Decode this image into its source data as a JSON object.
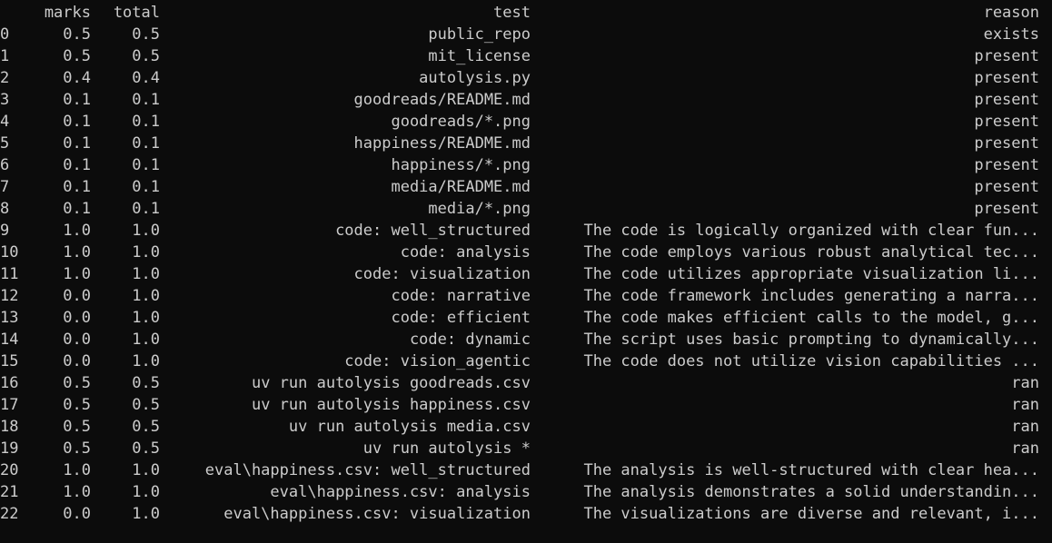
{
  "header": {
    "index": "",
    "marks": "marks",
    "total": "total",
    "test": "test",
    "reason": "reason"
  },
  "rows": [
    {
      "index": "0",
      "marks": "0.5",
      "total": "0.5",
      "test": "public_repo",
      "reason": "exists"
    },
    {
      "index": "1",
      "marks": "0.5",
      "total": "0.5",
      "test": "mit_license",
      "reason": "present"
    },
    {
      "index": "2",
      "marks": "0.4",
      "total": "0.4",
      "test": "autolysis.py",
      "reason": "present"
    },
    {
      "index": "3",
      "marks": "0.1",
      "total": "0.1",
      "test": "goodreads/README.md",
      "reason": "present"
    },
    {
      "index": "4",
      "marks": "0.1",
      "total": "0.1",
      "test": "goodreads/*.png",
      "reason": "present"
    },
    {
      "index": "5",
      "marks": "0.1",
      "total": "0.1",
      "test": "happiness/README.md",
      "reason": "present"
    },
    {
      "index": "6",
      "marks": "0.1",
      "total": "0.1",
      "test": "happiness/*.png",
      "reason": "present"
    },
    {
      "index": "7",
      "marks": "0.1",
      "total": "0.1",
      "test": "media/README.md",
      "reason": "present"
    },
    {
      "index": "8",
      "marks": "0.1",
      "total": "0.1",
      "test": "media/*.png",
      "reason": "present"
    },
    {
      "index": "9",
      "marks": "1.0",
      "total": "1.0",
      "test": "code: well_structured",
      "reason": "The code is logically organized with clear fun..."
    },
    {
      "index": "10",
      "marks": "1.0",
      "total": "1.0",
      "test": "code: analysis",
      "reason": "The code employs various robust analytical tec..."
    },
    {
      "index": "11",
      "marks": "1.0",
      "total": "1.0",
      "test": "code: visualization",
      "reason": "The code utilizes appropriate visualization li..."
    },
    {
      "index": "12",
      "marks": "0.0",
      "total": "1.0",
      "test": "code: narrative",
      "reason": "The code framework includes generating a narra..."
    },
    {
      "index": "13",
      "marks": "0.0",
      "total": "1.0",
      "test": "code: efficient",
      "reason": "The code makes efficient calls to the model, g..."
    },
    {
      "index": "14",
      "marks": "0.0",
      "total": "1.0",
      "test": "code: dynamic",
      "reason": "The script uses basic prompting to dynamically..."
    },
    {
      "index": "15",
      "marks": "0.0",
      "total": "1.0",
      "test": "code: vision_agentic",
      "reason": "The code does not utilize vision capabilities ..."
    },
    {
      "index": "16",
      "marks": "0.5",
      "total": "0.5",
      "test": "uv run autolysis goodreads.csv",
      "reason": "ran"
    },
    {
      "index": "17",
      "marks": "0.5",
      "total": "0.5",
      "test": "uv run autolysis happiness.csv",
      "reason": "ran"
    },
    {
      "index": "18",
      "marks": "0.5",
      "total": "0.5",
      "test": "uv run autolysis media.csv",
      "reason": "ran"
    },
    {
      "index": "19",
      "marks": "0.5",
      "total": "0.5",
      "test": "uv run autolysis *",
      "reason": "ran"
    },
    {
      "index": "20",
      "marks": "1.0",
      "total": "1.0",
      "test": "eval\\happiness.csv: well_structured",
      "reason": "The analysis is well-structured with clear hea..."
    },
    {
      "index": "21",
      "marks": "1.0",
      "total": "1.0",
      "test": "eval\\happiness.csv: analysis",
      "reason": "The analysis demonstrates a solid understandin..."
    },
    {
      "index": "22",
      "marks": "0.0",
      "total": "1.0",
      "test": "eval\\happiness.csv: visualization",
      "reason": "The visualizations are diverse and relevant, i..."
    }
  ],
  "colors": {
    "background": "#0c0c0c",
    "foreground": "#cccccc"
  }
}
